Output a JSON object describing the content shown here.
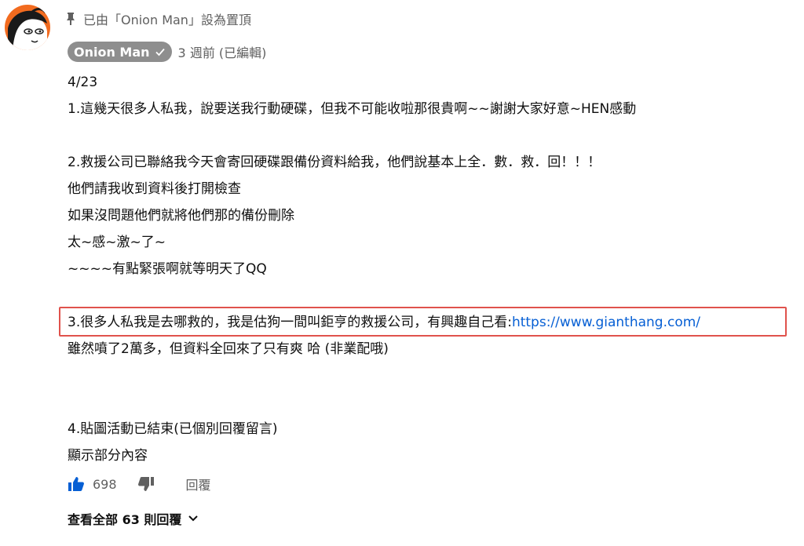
{
  "pinned": {
    "text": "已由「Onion Man」設為置頂",
    "icon": "pin-icon"
  },
  "author": {
    "name": "Onion Man",
    "verified_icon": "check-icon",
    "time": "3 週前 (已編輯)"
  },
  "comment": {
    "date": "4/23",
    "line1": "1.這幾天很多人私我，說要送我行動硬碟，但我不可能收啦那很貴啊~~謝謝大家好意~HEN感動",
    "line2": "2.救援公司已聯絡我今天會寄回硬碟跟備份資料給我，他們說基本上全．數．救．回！！！",
    "line3": "他們請我收到資料後打開檢查",
    "line4": "如果沒問題他們就將他們那的備份刪除",
    "line5": "太~感~激~了~",
    "line6": "~~~~有點緊張啊就等明天了QQ",
    "line7_text": "3.很多人私我是去哪救的，我是估狗一間叫鉅亨的救援公司，有興趣自己看:",
    "line7_link": "https://www.gianthang.com/",
    "line8": "雖然噴了2萬多，但資料全回來了只有爽  哈 (非業配哦)",
    "line9": "4.貼圖活動已結束(已個別回覆留言)",
    "show_more": "顯示部分內容"
  },
  "actions": {
    "like_count": "698",
    "reply_label": "回覆"
  },
  "replies": {
    "label": "查看全部 63 則回覆"
  },
  "colors": {
    "link": "#065fd4",
    "highlight": "#e0524c",
    "chip": "#8e8e8e",
    "avatar_bg": "#f26b1f"
  }
}
